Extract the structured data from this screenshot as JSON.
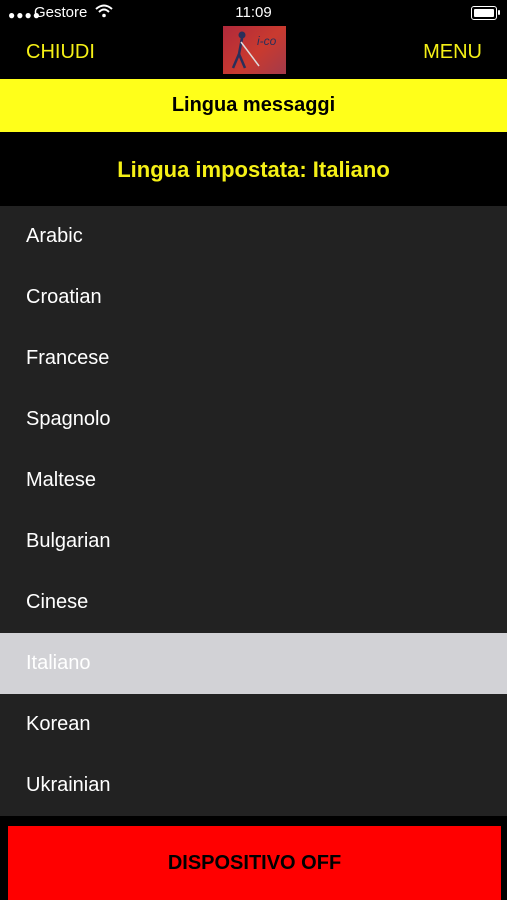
{
  "status_bar": {
    "carrier": "Gestore",
    "time": "11:09"
  },
  "nav": {
    "left_button": "CHIUDI",
    "right_button": "MENU",
    "logo_text": "i-co"
  },
  "header": {
    "title": "Lingua messaggi",
    "current_language": "Lingua impostata: Italiano"
  },
  "languages": [
    {
      "label": "Arabic",
      "selected": false
    },
    {
      "label": "Croatian",
      "selected": false
    },
    {
      "label": "Francese",
      "selected": false
    },
    {
      "label": "Spagnolo",
      "selected": false
    },
    {
      "label": "Maltese",
      "selected": false
    },
    {
      "label": "Bulgarian",
      "selected": false
    },
    {
      "label": "Cinese",
      "selected": false
    },
    {
      "label": "Italiano",
      "selected": true
    },
    {
      "label": "Korean",
      "selected": false
    },
    {
      "label": "Ukrainian",
      "selected": false
    }
  ],
  "footer": {
    "button": "DISPOSITIVO OFF"
  },
  "colors": {
    "accent_yellow": "#f5f016",
    "header_yellow": "#ffff1a",
    "list_bg": "#222222",
    "selected_bg": "#d2d2d6",
    "footer_red": "#ff0000"
  }
}
